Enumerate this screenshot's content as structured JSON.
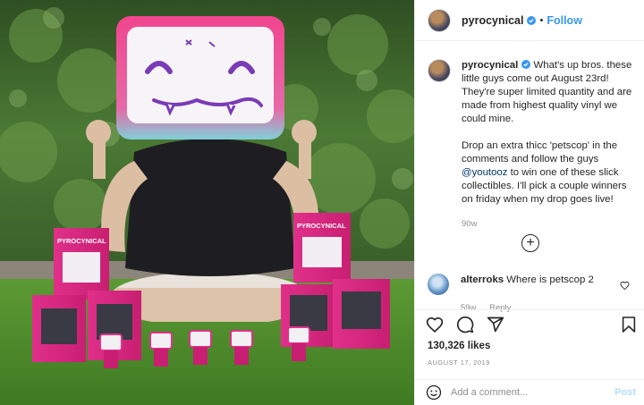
{
  "post": {
    "username": "pyrocynical",
    "separator": "•",
    "follow_label": "Follow",
    "caption_p1": "What's up bros. these little guys come out August 23rd! They're super limited quantity and are made from highest quality vinyl we could mine.",
    "caption_p2_before": "Drop an extra thicc 'petscop' in the comments and follow the guys",
    "mention": "@youtooz",
    "caption_p2_after": "to win one of these slick collectibles. I'll pick a couple winners on friday when my drop goes live!",
    "caption_time": "90w",
    "load_more_icon": "+",
    "likes": "130,326 likes",
    "date": "AUGUST 17, 2019"
  },
  "comments": [
    {
      "username": "alterroks",
      "text": "Where is petscop 2",
      "time": "59w",
      "reply_label": "Reply"
    }
  ],
  "composer": {
    "placeholder": "Add a comment...",
    "post_label": "Post"
  },
  "photo_text": {
    "box_label": "PYROCYNICAL"
  },
  "icons": {
    "verified": "verified-badge-icon",
    "heart": "heart-icon",
    "comment": "comment-icon",
    "share": "share-icon",
    "bookmark": "bookmark-icon",
    "emoji": "emoji-icon",
    "load_more": "plus-circle-icon"
  },
  "colors": {
    "accent": "#3897f0",
    "post_disabled": "#b2dffc",
    "mention": "#00376b",
    "muted": "#8e8e8e"
  }
}
